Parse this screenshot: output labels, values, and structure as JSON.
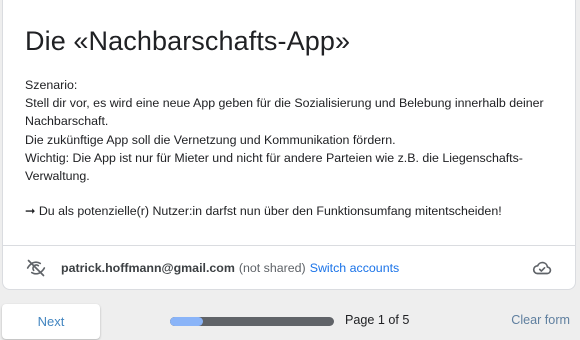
{
  "form": {
    "title": "Die «Nachbarschafts-App»",
    "description": [
      "Szenario:",
      "Stell dir vor, es wird eine neue App geben für die Sozialisierung und Belebung innerhalb deiner Nachbarschaft.",
      "Die zukünftige App soll die Vernetzung und Kommunikation fördern.",
      "Wichtig: Die App ist nur für Mieter und nicht für andere Parteien wie z.B. die Liegenschafts-Verwaltung.",
      "",
      "➞ Du als potenzielle(r) Nutzer:in darfst nun über den Funktionsumfang mitentscheiden!"
    ]
  },
  "account": {
    "email": "patrick.hoffmann@gmail.com",
    "shared_status": "(not shared)",
    "switch_label": "Switch accounts",
    "icon": "eye-off-icon",
    "save_icon": "cloud-check-icon"
  },
  "footer": {
    "next_label": "Next",
    "page_label": "Page 1 of 5",
    "progress_fraction": 0.2,
    "clear_label": "Clear form"
  },
  "colors": {
    "accent": "#1a73e8",
    "progress_fill": "#8ab4f8",
    "progress_track": "#606368"
  }
}
